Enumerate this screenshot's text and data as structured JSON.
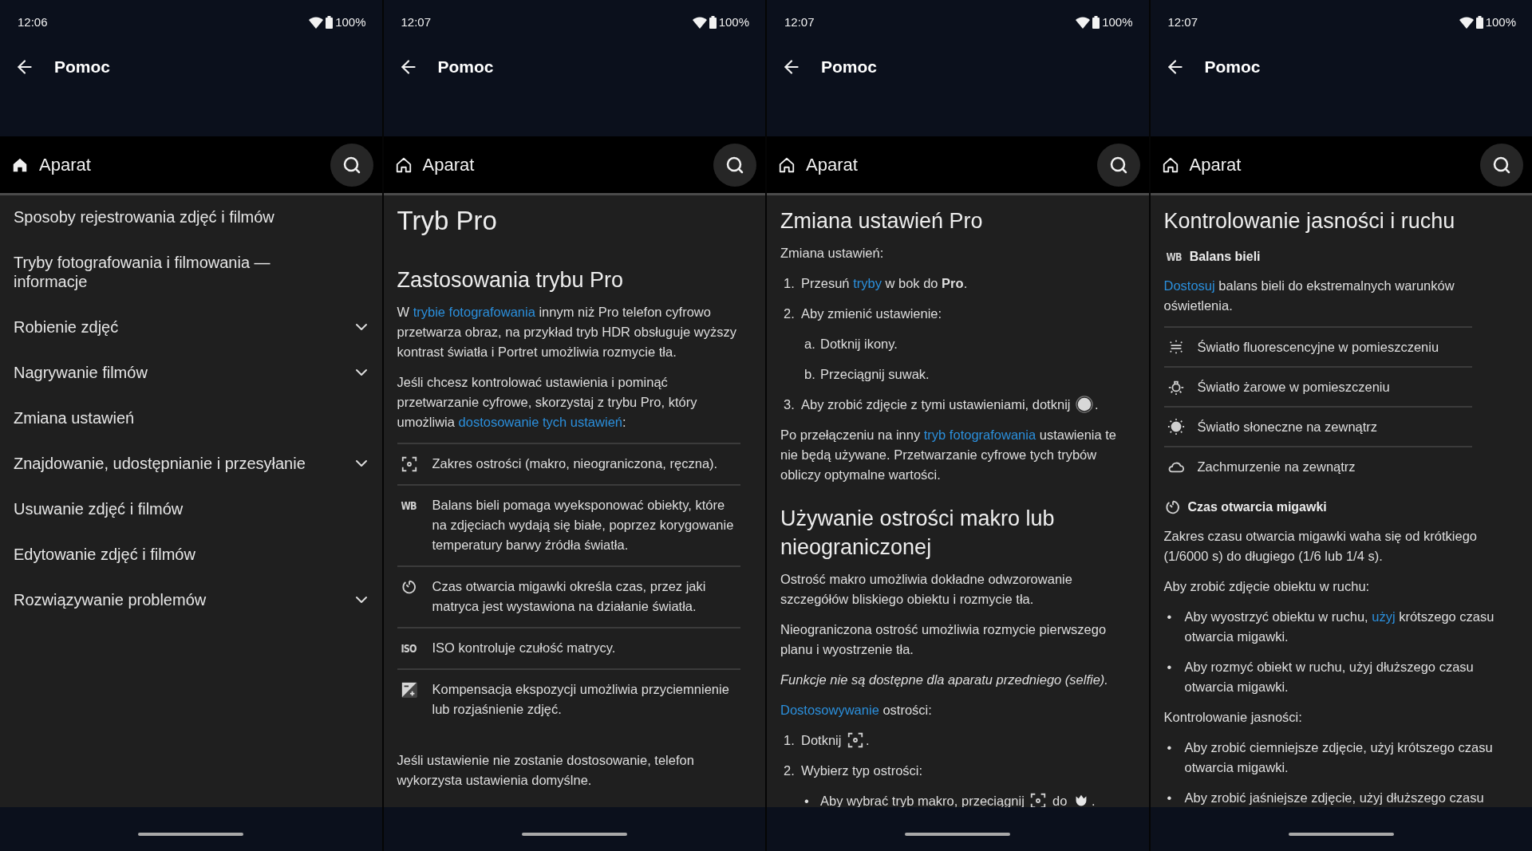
{
  "screens": [
    {
      "status": {
        "time": "12:06",
        "battery": "100%"
      },
      "appbar": {
        "title": "Pomoc"
      },
      "breadcrumb": {
        "label": "Aparat",
        "home_filled": true
      },
      "blocks": [
        {
          "kind": "menu",
          "items": [
            {
              "label": "Sposoby rejestrowania zdjęć i filmów",
              "expandable": false
            },
            {
              "label": "Tryby fotografowania i filmowania — informacje",
              "expandable": false
            },
            {
              "label": "Robienie zdjęć",
              "expandable": true
            },
            {
              "label": "Nagrywanie filmów",
              "expandable": true
            },
            {
              "label": "Zmiana ustawień",
              "expandable": false
            },
            {
              "label": "Znajdowanie, udostępnianie i przesyłanie",
              "expandable": true
            },
            {
              "label": "Usuwanie zdjęć i filmów",
              "expandable": false
            },
            {
              "label": "Edytowanie zdjęć i filmów",
              "expandable": false
            },
            {
              "label": "Rozwiązywanie problemów",
              "expandable": true
            }
          ]
        }
      ]
    },
    {
      "status": {
        "time": "12:07",
        "battery": "100%"
      },
      "appbar": {
        "title": "Pomoc"
      },
      "breadcrumb": {
        "label": "Aparat",
        "home_filled": false
      },
      "blocks": [
        {
          "kind": "title",
          "text": "Tryb Pro"
        },
        {
          "kind": "heading",
          "text": "Zastosowania trybu Pro"
        },
        {
          "kind": "paragraph",
          "italic": false,
          "segments": [
            {
              "kind": "plain",
              "text": "W "
            },
            {
              "kind": "link",
              "text": "trybie fotografowania"
            },
            {
              "kind": "plain",
              "text": " innym niż Pro telefon cyfrowo przetwarza obraz, na przykład tryb HDR obsługuje wyższy kontrast światła i Portret umożliwia rozmycie tła."
            }
          ]
        },
        {
          "kind": "paragraph",
          "italic": false,
          "segments": [
            {
              "kind": "plain",
              "text": "Jeśli chcesz kontrolować ustawienia i pominąć przetwarzanie cyfrowe, skorzystaj z trybu Pro, który umożliwia "
            },
            {
              "kind": "link",
              "text": "dostosowanie tych ustawień"
            },
            {
              "kind": "plain",
              "text": ":"
            }
          ]
        },
        {
          "kind": "feature_list",
          "items": [
            {
              "icon": {
                "kind": "focus"
              },
              "text": "Zakres ostrości (makro, nieograniczona, ręczna)."
            },
            {
              "icon": {
                "kind": "letters",
                "label": "WB"
              },
              "text": "Balans bieli pomaga wyeksponować obiekty, które na zdjęciach wydają się białe, poprzez korygowanie temperatury barwy źródła światła."
            },
            {
              "icon": {
                "kind": "timer"
              },
              "text": "Czas otwarcia migawki określa czas, przez jaki matryca jest wystawiona na działanie światła."
            },
            {
              "icon": {
                "kind": "letters",
                "label": "ISO"
              },
              "text": "ISO kontroluje czułość matrycy."
            },
            {
              "icon": {
                "kind": "exposure"
              },
              "text": "Kompensacja ekspozycji umożliwia przyciemnienie lub rozjaśnienie zdjęć."
            }
          ]
        },
        {
          "kind": "paragraph",
          "italic": false,
          "segments": [
            {
              "kind": "plain",
              "text": "Jeśli ustawienie nie zostanie dostosowanie, telefon wykorzysta ustawienia domyślne."
            }
          ]
        }
      ]
    },
    {
      "status": {
        "time": "12:07",
        "battery": "100%"
      },
      "appbar": {
        "title": "Pomoc"
      },
      "breadcrumb": {
        "label": "Aparat",
        "home_filled": false
      },
      "blocks": [
        {
          "kind": "heading",
          "text": "Zmiana ustawień Pro"
        },
        {
          "kind": "paragraph",
          "italic": false,
          "segments": [
            {
              "kind": "plain",
              "text": "Zmiana ustawień:"
            }
          ]
        },
        {
          "kind": "list",
          "items": [
            {
              "marker": "1.",
              "segments": [
                {
                  "kind": "plain",
                  "text": "Przesuń "
                },
                {
                  "kind": "link",
                  "text": "tryby"
                },
                {
                  "kind": "plain",
                  "text": " w bok do "
                },
                {
                  "kind": "bold",
                  "text": "Pro"
                },
                {
                  "kind": "plain",
                  "text": "."
                }
              ]
            },
            {
              "marker": "2.",
              "segments": [
                {
                  "kind": "plain",
                  "text": "Aby zmienić ustawienie:"
                }
              ],
              "children": [
                {
                  "marker": "a.",
                  "segments": [
                    {
                      "kind": "plain",
                      "text": "Dotknij ikony."
                    }
                  ]
                },
                {
                  "marker": "b.",
                  "segments": [
                    {
                      "kind": "plain",
                      "text": "Przeciągnij suwak."
                    }
                  ]
                }
              ]
            },
            {
              "marker": "3.",
              "segments": [
                {
                  "kind": "plain",
                  "text": "Aby zrobić zdjęcie z tymi ustawieniami, dotknij "
                },
                {
                  "kind": "icon",
                  "icon": {
                    "kind": "shutter_button"
                  }
                },
                {
                  "kind": "plain",
                  "text": "."
                }
              ]
            }
          ]
        },
        {
          "kind": "paragraph",
          "italic": false,
          "segments": [
            {
              "kind": "plain",
              "text": "Po przełączeniu na inny "
            },
            {
              "kind": "link",
              "text": "tryb fotografowania"
            },
            {
              "kind": "plain",
              "text": " ustawienia te nie będą używane. Przetwarzanie cyfrowe tych trybów obliczy optymalne wartości."
            }
          ]
        },
        {
          "kind": "heading",
          "text": "Używanie ostrości makro lub nieograniczonej"
        },
        {
          "kind": "paragraph",
          "italic": false,
          "segments": [
            {
              "kind": "plain",
              "text": "Ostrość makro umożliwia dokładne odwzorowanie szczegółów bliskiego obiektu i rozmycie tła."
            }
          ]
        },
        {
          "kind": "paragraph",
          "italic": false,
          "segments": [
            {
              "kind": "plain",
              "text": "Nieograniczona ostrość umożliwia rozmycie pierwszego planu i wyostrzenie tła."
            }
          ]
        },
        {
          "kind": "paragraph",
          "italic": true,
          "segments": [
            {
              "kind": "plain",
              "text": "Funkcje nie są dostępne dla aparatu przedniego (selfie)."
            }
          ]
        },
        {
          "kind": "paragraph",
          "italic": false,
          "segments": [
            {
              "kind": "link",
              "text": "Dostosowywanie"
            },
            {
              "kind": "plain",
              "text": " ostrości:"
            }
          ]
        },
        {
          "kind": "list",
          "items": [
            {
              "marker": "1.",
              "segments": [
                {
                  "kind": "plain",
                  "text": "Dotknij "
                },
                {
                  "kind": "icon",
                  "icon": {
                    "kind": "focus"
                  }
                },
                {
                  "kind": "plain",
                  "text": "."
                }
              ]
            },
            {
              "marker": "2.",
              "segments": [
                {
                  "kind": "plain",
                  "text": "Wybierz typ ostrości:"
                }
              ],
              "children": [
                {
                  "marker": "•",
                  "segments": [
                    {
                      "kind": "plain",
                      "text": "Aby wybrać tryb makro, przeciągnij "
                    },
                    {
                      "kind": "icon",
                      "icon": {
                        "kind": "focus"
                      }
                    },
                    {
                      "kind": "plain",
                      "text": " do "
                    },
                    {
                      "kind": "icon",
                      "icon": {
                        "kind": "flower"
                      }
                    },
                    {
                      "kind": "plain",
                      "text": "."
                    }
                  ]
                }
              ]
            }
          ]
        }
      ]
    },
    {
      "status": {
        "time": "12:07",
        "battery": "100%"
      },
      "appbar": {
        "title": "Pomoc"
      },
      "breadcrumb": {
        "label": "Aparat",
        "home_filled": false
      },
      "blocks": [
        {
          "kind": "heading",
          "text": "Kontrolowanie jasności i ruchu"
        },
        {
          "kind": "subheading",
          "icon": {
            "kind": "letters",
            "label": "WB"
          },
          "text": "Balans bieli"
        },
        {
          "kind": "paragraph",
          "italic": false,
          "segments": [
            {
              "kind": "link",
              "text": "Dostosuj"
            },
            {
              "kind": "plain",
              "text": " balans bieli do ekstremalnych warunków oświetlenia."
            }
          ]
        },
        {
          "kind": "option_list",
          "items": [
            {
              "icon": {
                "kind": "fluorescent"
              },
              "text": "Światło fluorescencyjne w pomieszczeniu"
            },
            {
              "icon": {
                "kind": "bulb"
              },
              "text": "Światło żarowe w pomieszczeniu"
            },
            {
              "icon": {
                "kind": "sun"
              },
              "text": "Światło słoneczne na zewnątrz"
            },
            {
              "icon": {
                "kind": "cloud"
              },
              "text": "Zachmurzenie na zewnątrz"
            }
          ]
        },
        {
          "kind": "subheading",
          "icon": {
            "kind": "timer"
          },
          "text": "Czas otwarcia migawki"
        },
        {
          "kind": "paragraph",
          "italic": false,
          "segments": [
            {
              "kind": "plain",
              "text": "Zakres czasu otwarcia migawki waha się od krótkiego (1/6000 s) do długiego (1/6 lub 1/4 s)."
            }
          ]
        },
        {
          "kind": "paragraph",
          "italic": false,
          "segments": [
            {
              "kind": "plain",
              "text": "Aby zrobić zdjęcie obiektu w ruchu:"
            }
          ]
        },
        {
          "kind": "list",
          "items": [
            {
              "marker": "•",
              "segments": [
                {
                  "kind": "plain",
                  "text": "Aby wyostrzyć obiektu w ruchu, "
                },
                {
                  "kind": "link",
                  "text": "użyj"
                },
                {
                  "kind": "plain",
                  "text": " krótszego czasu otwarcia migawki."
                }
              ]
            },
            {
              "marker": "•",
              "segments": [
                {
                  "kind": "plain",
                  "text": "Aby rozmyć obiekt w ruchu, użyj dłuższego czasu otwarcia migawki."
                }
              ]
            }
          ]
        },
        {
          "kind": "paragraph",
          "italic": false,
          "segments": [
            {
              "kind": "plain",
              "text": "Kontrolowanie jasności:"
            }
          ]
        },
        {
          "kind": "list",
          "items": [
            {
              "marker": "•",
              "segments": [
                {
                  "kind": "plain",
                  "text": "Aby zrobić ciemniejsze zdjęcie, użyj krótszego czasu otwarcia migawki."
                }
              ]
            },
            {
              "marker": "•",
              "segments": [
                {
                  "kind": "plain",
                  "text": "Aby zrobić jaśniejsze zdjęcie, użyj dłuższego czasu"
                }
              ]
            }
          ]
        }
      ]
    }
  ]
}
